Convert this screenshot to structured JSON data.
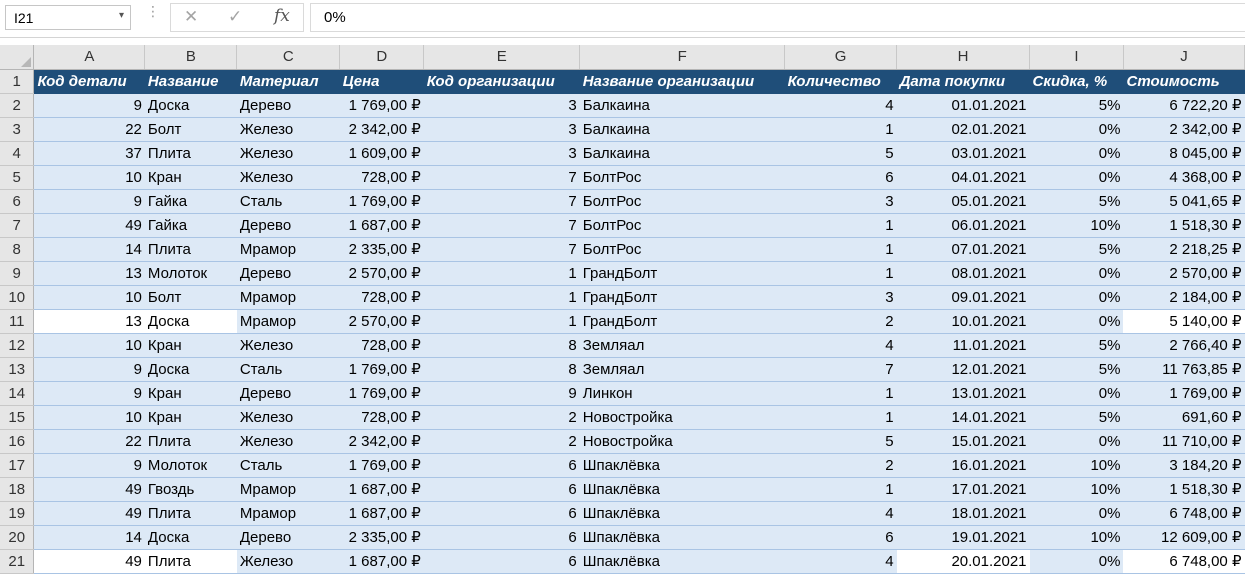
{
  "formula_bar": {
    "name_box": "I21",
    "name_box_arrow": "▾",
    "cancel_icon": "✕",
    "enter_icon": "✓",
    "fx_label": "fx",
    "formula": "0%"
  },
  "columns": [
    "A",
    "B",
    "C",
    "D",
    "E",
    "F",
    "G",
    "H",
    "I",
    "J"
  ],
  "header_row": {
    "row_number": "1",
    "cells": [
      "Код детали",
      "Название",
      "Материал",
      "Цена",
      "Код организации",
      "Название организации",
      "Количество",
      "Дата покупки",
      "Скидка, %",
      "Стоимость"
    ]
  },
  "rows": [
    {
      "n": "2",
      "c": [
        "9",
        "Доска",
        "Дерево",
        "1 769,00 ₽",
        "3",
        "Балкаина",
        "4",
        "01.01.2021",
        "5%",
        "6 722,20 ₽"
      ]
    },
    {
      "n": "3",
      "c": [
        "22",
        "Болт",
        "Железо",
        "2 342,00 ₽",
        "3",
        "Балкаина",
        "1",
        "02.01.2021",
        "0%",
        "2 342,00 ₽"
      ]
    },
    {
      "n": "4",
      "c": [
        "37",
        "Плита",
        "Железо",
        "1 609,00 ₽",
        "3",
        "Балкаина",
        "5",
        "03.01.2021",
        "0%",
        "8 045,00 ₽"
      ]
    },
    {
      "n": "5",
      "c": [
        "10",
        "Кран",
        "Железо",
        "728,00 ₽",
        "7",
        "БолтРос",
        "6",
        "04.01.2021",
        "0%",
        "4 368,00 ₽"
      ]
    },
    {
      "n": "6",
      "c": [
        "9",
        "Гайка",
        "Сталь",
        "1 769,00 ₽",
        "7",
        "БолтРос",
        "3",
        "05.01.2021",
        "5%",
        "5 041,65 ₽"
      ]
    },
    {
      "n": "7",
      "c": [
        "49",
        "Гайка",
        "Дерево",
        "1 687,00 ₽",
        "7",
        "БолтРос",
        "1",
        "06.01.2021",
        "10%",
        "1 518,30 ₽"
      ]
    },
    {
      "n": "8",
      "c": [
        "14",
        "Плита",
        "Мрамор",
        "2 335,00 ₽",
        "7",
        "БолтРос",
        "1",
        "07.01.2021",
        "5%",
        "2 218,25 ₽"
      ]
    },
    {
      "n": "9",
      "c": [
        "13",
        "Молоток",
        "Дерево",
        "2 570,00 ₽",
        "1",
        "ГрандБолт",
        "1",
        "08.01.2021",
        "0%",
        "2 570,00 ₽"
      ]
    },
    {
      "n": "10",
      "c": [
        "10",
        "Болт",
        "Мрамор",
        "728,00 ₽",
        "1",
        "ГрандБолт",
        "3",
        "09.01.2021",
        "0%",
        "2 184,00 ₽"
      ]
    },
    {
      "n": "11",
      "c": [
        "13",
        "Доска",
        "Мрамор",
        "2 570,00 ₽",
        "1",
        "ГрандБолт",
        "2",
        "10.01.2021",
        "0%",
        "5 140,00 ₽"
      ]
    },
    {
      "n": "12",
      "c": [
        "10",
        "Кран",
        "Железо",
        "728,00 ₽",
        "8",
        "Земляал",
        "4",
        "11.01.2021",
        "5%",
        "2 766,40 ₽"
      ]
    },
    {
      "n": "13",
      "c": [
        "9",
        "Доска",
        "Сталь",
        "1 769,00 ₽",
        "8",
        "Земляал",
        "7",
        "12.01.2021",
        "5%",
        "11 763,85 ₽"
      ]
    },
    {
      "n": "14",
      "c": [
        "9",
        "Кран",
        "Дерево",
        "1 769,00 ₽",
        "9",
        "Линкон",
        "1",
        "13.01.2021",
        "0%",
        "1 769,00 ₽"
      ]
    },
    {
      "n": "15",
      "c": [
        "10",
        "Кран",
        "Железо",
        "728,00 ₽",
        "2",
        "Новостройка",
        "1",
        "14.01.2021",
        "5%",
        "691,60 ₽"
      ]
    },
    {
      "n": "16",
      "c": [
        "22",
        "Плита",
        "Железо",
        "2 342,00 ₽",
        "2",
        "Новостройка",
        "5",
        "15.01.2021",
        "0%",
        "11 710,00 ₽"
      ]
    },
    {
      "n": "17",
      "c": [
        "9",
        "Молоток",
        "Сталь",
        "1 769,00 ₽",
        "6",
        "Шпаклёвка",
        "2",
        "16.01.2021",
        "10%",
        "3 184,20 ₽"
      ]
    },
    {
      "n": "18",
      "c": [
        "49",
        "Гвоздь",
        "Мрамор",
        "1 687,00 ₽",
        "6",
        "Шпаклёвка",
        "1",
        "17.01.2021",
        "10%",
        "1 518,30 ₽"
      ]
    },
    {
      "n": "19",
      "c": [
        "49",
        "Плита",
        "Мрамор",
        "1 687,00 ₽",
        "6",
        "Шпаклёвка",
        "4",
        "18.01.2021",
        "0%",
        "6 748,00 ₽"
      ]
    },
    {
      "n": "20",
      "c": [
        "14",
        "Доска",
        "Дерево",
        "2 335,00 ₽",
        "6",
        "Шпаклёвка",
        "6",
        "19.01.2021",
        "10%",
        "12 609,00 ₽"
      ]
    },
    {
      "n": "21",
      "c": [
        "49",
        "Плита",
        "Железо",
        "1 687,00 ₽",
        "6",
        "Шпаклёвка",
        "4",
        "20.01.2021",
        "0%",
        "6 748,00 ₽"
      ]
    }
  ],
  "colors": {
    "header_fill": "#1f4e79",
    "band_fill": "#dde9f6",
    "plain_fill": "#ffffff"
  }
}
